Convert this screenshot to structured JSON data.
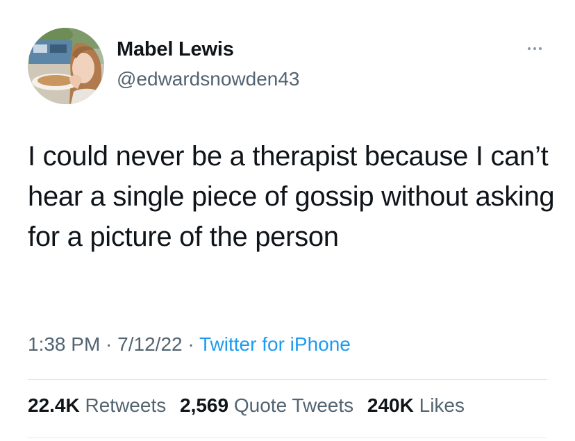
{
  "user": {
    "display_name": "Mabel Lewis",
    "handle": "@edwardsnowden43",
    "avatar_icon": "profile-photo"
  },
  "more_icon": "ellipsis-icon",
  "tweet": {
    "text": "I could never be a therapist because I can’t hear a single piece of gossip without asking for a picture of the person"
  },
  "meta": {
    "time": "1:38 PM",
    "separator": " · ",
    "date": "7/12/22",
    "source": "Twitter for iPhone"
  },
  "stats": {
    "retweets_count": "22.4K",
    "retweets_label": "Retweets",
    "quotes_count": "2,569",
    "quotes_label": "Quote Tweets",
    "likes_count": "240K",
    "likes_label": "Likes"
  },
  "colors": {
    "text_primary": "#0f1419",
    "text_secondary": "#536471",
    "link": "#1d9bf0",
    "divider": "#e1e6ea"
  }
}
